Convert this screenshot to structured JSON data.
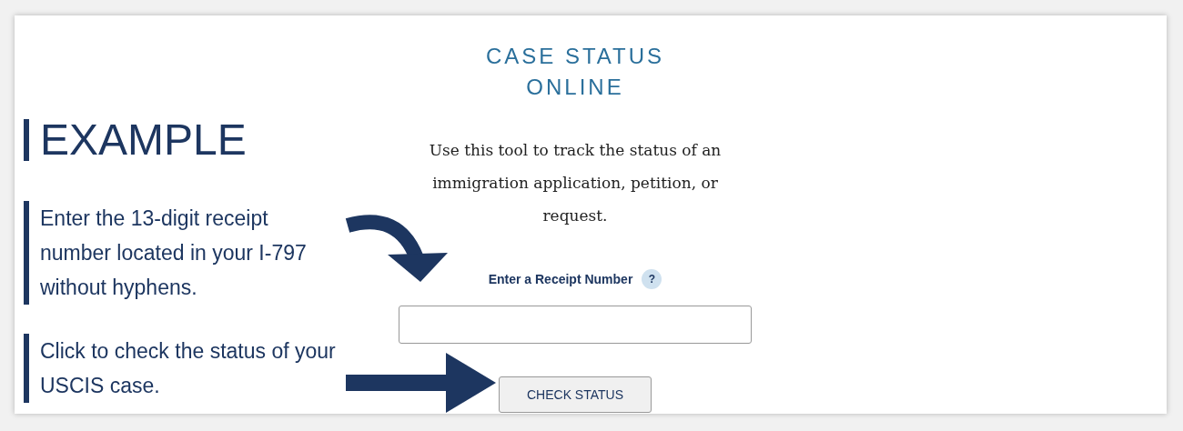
{
  "form": {
    "title": "CASE STATUS ONLINE",
    "description": "Use this tool to track the status of an immigration application, petition, or request.",
    "field_label": "Enter a Receipt Number",
    "help_icon": "?",
    "button": "CHECK STATUS"
  },
  "annotations": {
    "heading": "EXAMPLE",
    "notes": [
      {
        "text": "Enter the 13-digit receipt number located in your I-797 without hyphens."
      },
      {
        "text": "Click to check the status of your USCIS case."
      }
    ]
  }
}
